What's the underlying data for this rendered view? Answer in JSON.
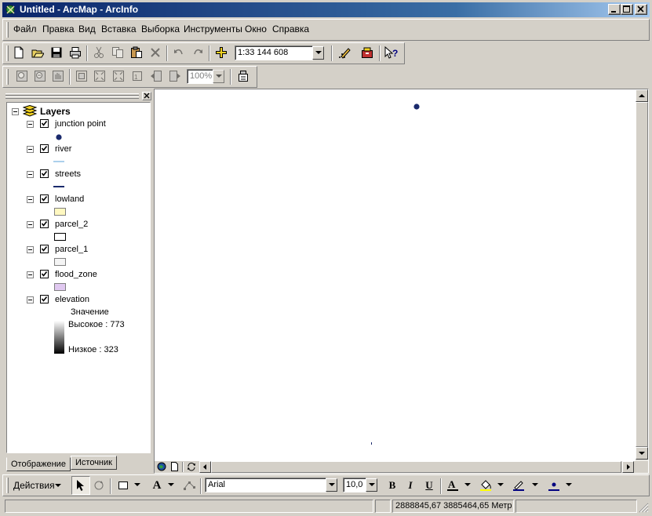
{
  "window": {
    "title": "Untitled - ArcMap - ArcInfo",
    "controls": [
      "minimize-icon",
      "maximize-icon",
      "close-icon"
    ]
  },
  "menu": [
    "Файл",
    "Правка",
    "Вид",
    "Вставка",
    "Выборка",
    "Инструменты",
    "Окно",
    "Справка"
  ],
  "standard_toolbar": {
    "scale": "1:33 144 608",
    "buttons": [
      "new-icon",
      "open-icon",
      "save-icon",
      "print-icon",
      "cut-icon",
      "copy-icon",
      "paste-icon",
      "delete-icon",
      "undo-icon",
      "redo-icon",
      "add-data-icon",
      "editor-icon",
      "arctoolbox-icon",
      "whats-this-icon"
    ]
  },
  "layout_toolbar": {
    "zoom": "100%"
  },
  "toc": {
    "root": "Layers",
    "layers": [
      {
        "name": "junction point",
        "symbol": "point",
        "color": "#1a2a6c"
      },
      {
        "name": "river",
        "symbol": "line",
        "color": "#5aa0d8"
      },
      {
        "name": "streets",
        "symbol": "line",
        "color": "#1a2a6c"
      },
      {
        "name": "lowland",
        "symbol": "polygon",
        "color": "#fff8c0"
      },
      {
        "name": "parcel_2",
        "symbol": "polygon",
        "color": "#ffffff"
      },
      {
        "name": "parcel_1",
        "symbol": "polygon",
        "color": "#f4f4f4"
      },
      {
        "name": "flood_zone",
        "symbol": "polygon",
        "color": "#e0c8f0"
      },
      {
        "name": "elevation",
        "symbol": "raster",
        "color": "#000000"
      }
    ],
    "elevation_legend": {
      "heading": "Значение",
      "high": "Высокое : 773",
      "low": "Низкое : 323"
    },
    "tabs": [
      "Отображение",
      "Источник"
    ]
  },
  "drawing_toolbar": {
    "actions_label": "Действия",
    "font": "Arial",
    "font_size": "10,0",
    "bold": "B",
    "italic": "I",
    "underline": "U",
    "text_color_glyph": "A"
  },
  "status_bar": {
    "coordinates": "2888845,67  3885464,65 Метр"
  }
}
